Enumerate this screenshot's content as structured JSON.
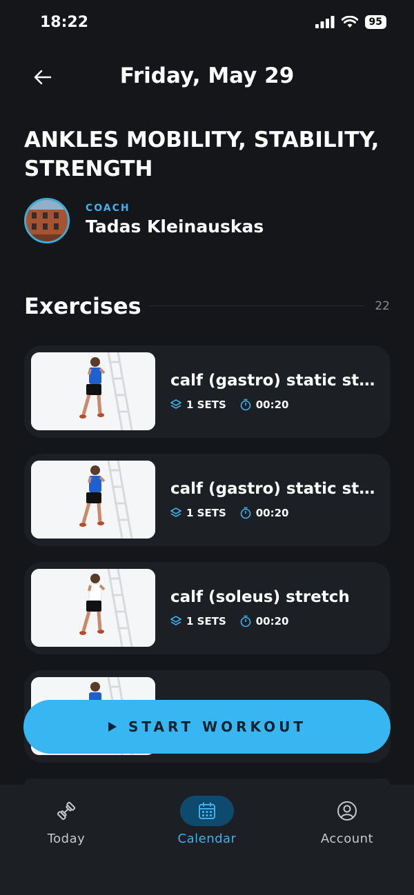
{
  "status": {
    "time": "18:22",
    "battery": "95"
  },
  "header": {
    "title": "Friday, May 29"
  },
  "workout": {
    "title": "ANKLES MOBILITY, STABILITY, STRENGTH",
    "coach_label": "COACH",
    "coach_name": "Tadas Kleinauskas"
  },
  "exercises": {
    "heading": "Exercises",
    "count": "22",
    "items": [
      {
        "name": "calf (gastro) static str...",
        "sets": "1 SETS",
        "time": "00:20"
      },
      {
        "name": "calf (gastro) static str...",
        "sets": "1 SETS",
        "time": "00:20"
      },
      {
        "name": "calf (soleus) stretch",
        "sets": "1 SETS",
        "time": "00:20"
      }
    ]
  },
  "start_button": {
    "label": "START WORKOUT"
  },
  "tabbar": {
    "tabs": [
      {
        "label": "Today",
        "icon": "dumbbell-icon"
      },
      {
        "label": "Calendar",
        "icon": "calendar-icon",
        "active": true
      },
      {
        "label": "Account",
        "icon": "user-circle-icon"
      }
    ]
  },
  "colors": {
    "accent": "#38b6f2",
    "background": "#141619",
    "card": "#1c1f24"
  }
}
